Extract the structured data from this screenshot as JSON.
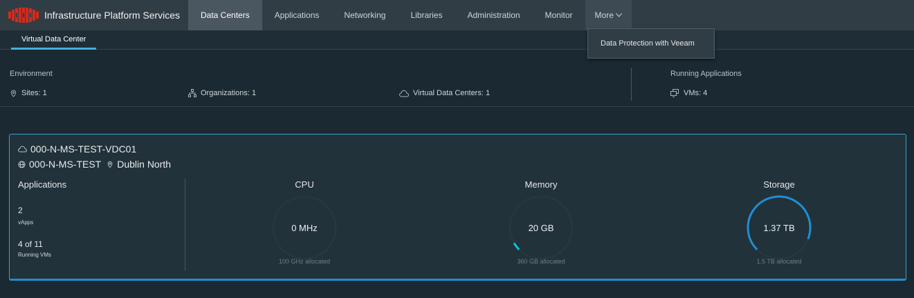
{
  "header": {
    "app_title": "Infrastructure Platform Services",
    "nav": [
      {
        "label": "Data Centers",
        "active": true
      },
      {
        "label": "Applications"
      },
      {
        "label": "Networking"
      },
      {
        "label": "Libraries"
      },
      {
        "label": "Administration"
      },
      {
        "label": "Monitor"
      }
    ],
    "more_label": "More",
    "more_menu": [
      "Data Protection with Veeam"
    ]
  },
  "subnav": {
    "tab": "Virtual Data Center"
  },
  "summary": {
    "environment_label": "Environment",
    "sites": "Sites: 1",
    "organizations": "Organizations: 1",
    "vdcs": "Virtual Data Centers: 1",
    "running_label": "Running Applications",
    "vms": "VMs: 4"
  },
  "vdc": {
    "name": "000-N-MS-TEST-VDC01",
    "org": "000-N-MS-TEST",
    "location": "Dublin North",
    "apps_title": "Applications",
    "vapps_count": "2",
    "vapps_label": "vApps",
    "running_vms": "4 of 11",
    "running_vms_label": "Running VMs",
    "gauges": [
      {
        "title": "CPU",
        "value": "0 MHz",
        "allocated": "100 GHz allocated",
        "fraction": 0.0,
        "color": "#1f8fd4"
      },
      {
        "title": "Memory",
        "value": "20 GB",
        "allocated": "360 GB allocated",
        "fraction": 0.056,
        "color": "#00c8e0"
      },
      {
        "title": "Storage",
        "value": "1.37 TB",
        "allocated": "1.5 TB allocated",
        "fraction": 0.913,
        "color": "#1f8fd4"
      }
    ]
  },
  "colors": {
    "accent": "#49afd9",
    "card_border": "#3a9fc9",
    "logo_red": "#d7291c"
  }
}
